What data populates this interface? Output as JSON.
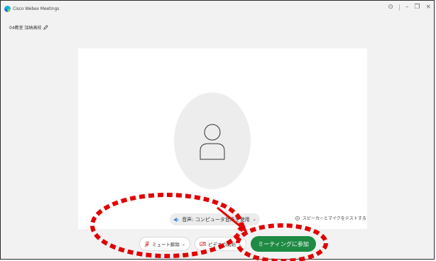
{
  "window": {
    "title": "Cisco Webex Meetings",
    "controls": [
      "⊙",
      "–",
      "❐",
      "×"
    ]
  },
  "meeting": {
    "name": "04教室 加納高校",
    "edit_icon": "pencil-icon"
  },
  "preview": {
    "avatar_icon": "person-silhouette-icon"
  },
  "audio": {
    "label": "音声: コンピュータ音声を使用",
    "dropdown_icon": "chevron-down-icon"
  },
  "speaker_test": {
    "label": "スピーカーとマイクをテストする",
    "icon": "speaker-gear-icon"
  },
  "controls": {
    "mute_label": "ミュート解除",
    "video_label": "ビデオの開始",
    "join_label": "ミーティングに参加"
  },
  "colors": {
    "join_green": "#1f8a44",
    "annotation_red": "#e00000",
    "mic_off_red": "#d63a3a"
  }
}
